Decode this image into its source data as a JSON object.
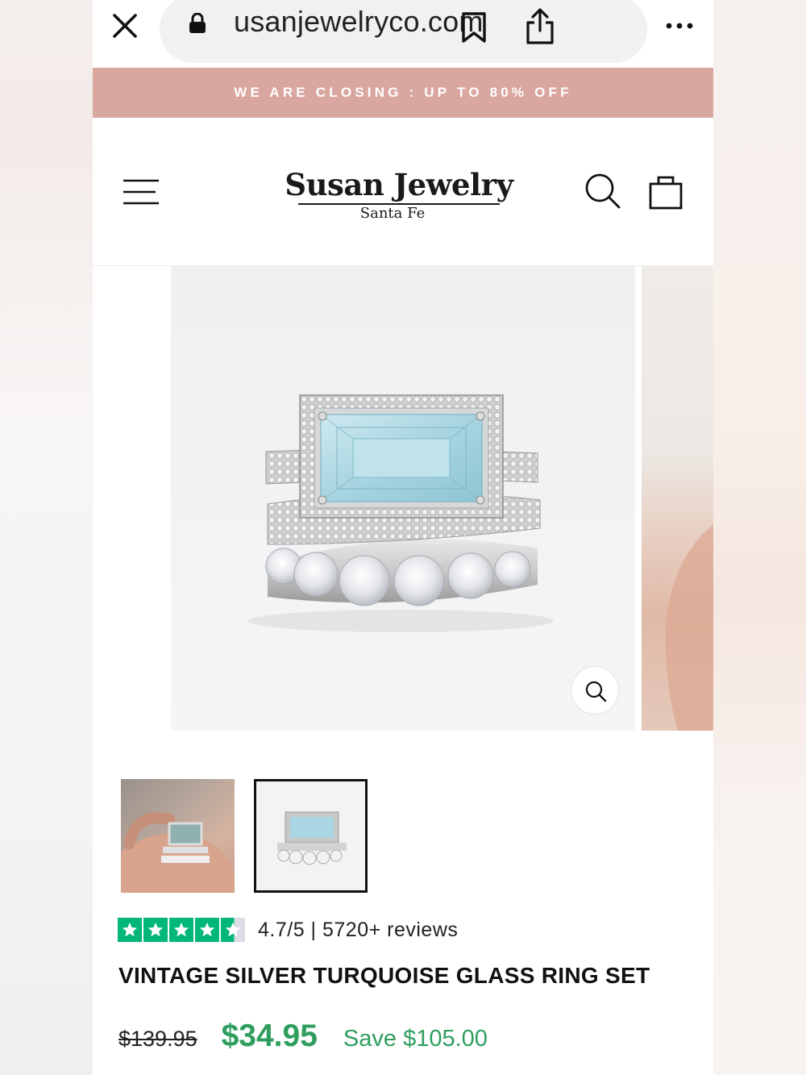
{
  "browser": {
    "url": "usanjewelryco.com"
  },
  "promo": {
    "text": "WE ARE CLOSING : UP TO 80% OFF"
  },
  "header": {
    "logo_title": "Susan Jewelry",
    "logo_subtitle": "Santa Fe"
  },
  "product": {
    "rating": "4.7/5 | 5720+ reviews",
    "stars": 4.7,
    "title": "VINTAGE SILVER TURQUOISE GLASS RING SET",
    "old_price": "$139.95",
    "price": "$34.95",
    "save": "Save $105.00"
  },
  "colors": {
    "promo_bg": "#d9a7a0",
    "price_green": "#2f9e5f",
    "star_green": "#00b67a"
  }
}
